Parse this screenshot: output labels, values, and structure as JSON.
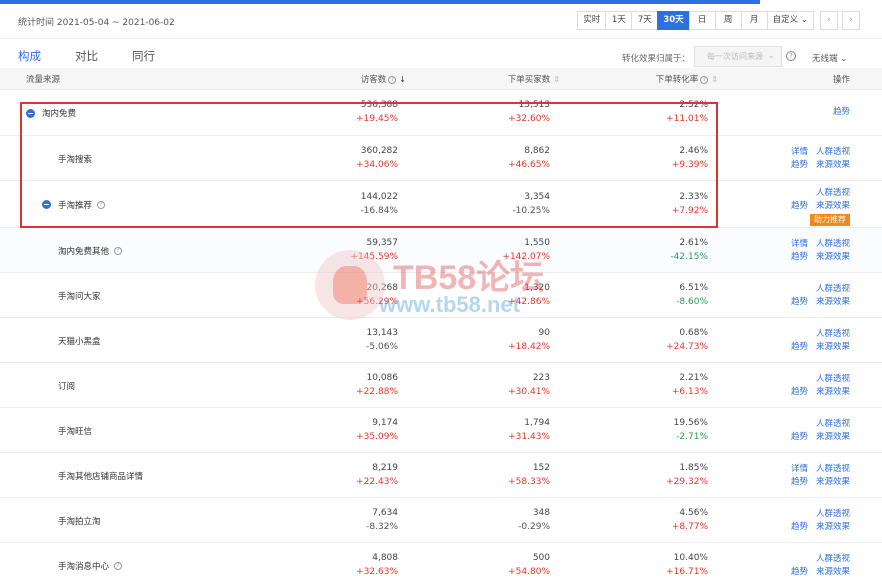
{
  "header": {
    "date_label": "统计时间 2021-05-04 ~ 2021-06-02",
    "range_buttons": [
      "实时",
      "1天",
      "7天",
      "30天",
      "日",
      "周",
      "月",
      "自定义"
    ],
    "active_range": "30天",
    "prev_glyph": "‹",
    "next_glyph": "›"
  },
  "tabs": [
    "构成",
    "对比",
    "同行"
  ],
  "active_tab": "构成",
  "attribution": {
    "label": "转化效果归属于：",
    "placeholder": "每一次访问来源",
    "wrap_label": "无线端"
  },
  "table": {
    "columns": {
      "source": "流量来源",
      "visitors": "访客数",
      "buyers": "下单买家数",
      "conversion": "下单转化率",
      "actions": "操作"
    },
    "rows": [
      {
        "name": "淘内免费",
        "visitors": "536,388",
        "visitors_change": "+19.45%",
        "buyers": "13,513",
        "buyers_change": "+32.60%",
        "conv": "2.52%",
        "conv_change": "+11.01%",
        "actions": [
          "趋势"
        ],
        "badge": ""
      },
      {
        "name": "手淘搜索",
        "visitors": "360,282",
        "visitors_change": "+34.06%",
        "buyers": "8,862",
        "buyers_change": "+46.65%",
        "conv": "2.46%",
        "conv_change": "+9.39%",
        "actions": [
          "详情",
          "人群透视",
          "趋势",
          "来源效果"
        ],
        "badge": ""
      },
      {
        "name": "手淘推荐",
        "visitors": "144,022",
        "visitors_change": "-16.84%",
        "buyers": "3,354",
        "buyers_change": "-10.25%",
        "conv": "2.33%",
        "conv_change": "+7.92%",
        "actions": [
          "人群透视",
          "趋势",
          "来源效果"
        ],
        "badge": "助力推荐"
      },
      {
        "name": "淘内免费其他",
        "visitors": "59,357",
        "visitors_change": "+145.59%",
        "buyers": "1,550",
        "buyers_change": "+142.07%",
        "conv": "2.61%",
        "conv_change": "-42.15%",
        "actions": [
          "详情",
          "人群透视",
          "趋势",
          "来源效果"
        ],
        "badge": ""
      },
      {
        "name": "手淘问大家",
        "visitors": "20,268",
        "visitors_change": "+56.29%",
        "buyers": "1,320",
        "buyers_change": "+42.86%",
        "conv": "6.51%",
        "conv_change": "-8.60%",
        "actions": [
          "人群透视",
          "趋势",
          "来源效果"
        ],
        "badge": ""
      },
      {
        "name": "天猫小黑盒",
        "visitors": "13,143",
        "visitors_change": "-5.06%",
        "buyers": "90",
        "buyers_change": "+18.42%",
        "conv": "0.68%",
        "conv_change": "+24.73%",
        "actions": [
          "人群透视",
          "趋势",
          "来源效果"
        ],
        "badge": ""
      },
      {
        "name": "订阅",
        "visitors": "10,086",
        "visitors_change": "+22.88%",
        "buyers": "223",
        "buyers_change": "+30.41%",
        "conv": "2.21%",
        "conv_change": "+6.13%",
        "actions": [
          "人群透视",
          "趋势",
          "来源效果"
        ],
        "badge": ""
      },
      {
        "name": "手淘旺信",
        "visitors": "9,174",
        "visitors_change": "+35.09%",
        "buyers": "1,794",
        "buyers_change": "+31.43%",
        "conv": "19.56%",
        "conv_change": "-2.71%",
        "actions": [
          "人群透视",
          "趋势",
          "来源效果"
        ],
        "badge": ""
      },
      {
        "name": "手淘其他店铺商品详情",
        "visitors": "8,219",
        "visitors_change": "+22.43%",
        "buyers": "152",
        "buyers_change": "+58.33%",
        "conv": "1.85%",
        "conv_change": "+29.32%",
        "actions": [
          "详情",
          "人群透视",
          "趋势",
          "来源效果"
        ],
        "badge": ""
      },
      {
        "name": "手淘拍立淘",
        "visitors": "7,634",
        "visitors_change": "-8.32%",
        "buyers": "348",
        "buyers_change": "-0.29%",
        "conv": "4.56%",
        "conv_change": "+8.77%",
        "actions": [
          "人群透视",
          "趋势",
          "来源效果"
        ],
        "badge": ""
      },
      {
        "name": "手淘消息中心",
        "visitors": "4,808",
        "visitors_change": "+32.63%",
        "buyers": "500",
        "buyers_change": "+54.80%",
        "conv": "10.40%",
        "conv_change": "+16.71%",
        "actions": [
          "人群透视",
          "趋势",
          "来源效果"
        ],
        "badge": ""
      }
    ]
  },
  "watermark": {
    "line1": "TB58论坛",
    "line2": "www.tb58.net"
  },
  "colors": {
    "accent": "#2f6fe0",
    "up": "#e8352b",
    "down_green": "#2e9d57",
    "badge": "#f0881d",
    "highlight": "#dd3333"
  }
}
